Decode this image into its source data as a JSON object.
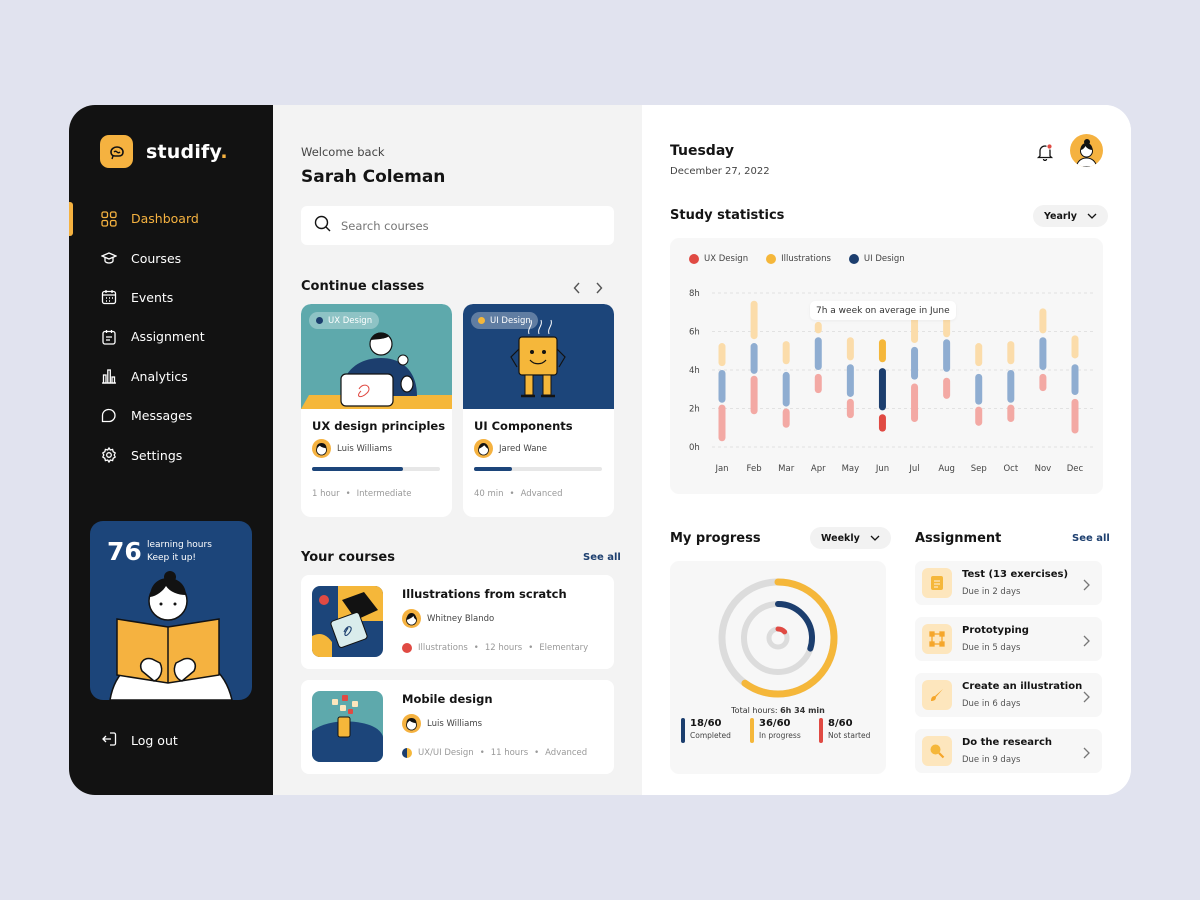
{
  "app": {
    "name": "studify",
    "name_dot": "."
  },
  "sidebar": {
    "items": [
      {
        "label": "Dashboard",
        "icon": "grid-icon"
      },
      {
        "label": "Courses",
        "icon": "graduation-cap-icon"
      },
      {
        "label": "Events",
        "icon": "calendar-icon"
      },
      {
        "label": "Assignment",
        "icon": "clipboard-icon"
      },
      {
        "label": "Analytics",
        "icon": "bar-chart-icon"
      },
      {
        "label": "Messages",
        "icon": "chat-icon"
      },
      {
        "label": "Settings",
        "icon": "gear-icon"
      }
    ],
    "promo": {
      "number": "76",
      "line1": "learning hours",
      "line2": "Keep it up!"
    },
    "logout": "Log out"
  },
  "main": {
    "welcome": "Welcome back",
    "user": "Sarah Coleman",
    "search_placeholder": "Search courses",
    "continue_title": "Continue classes",
    "continue_cards": [
      {
        "tag": "UX Design",
        "title": "UX design principles",
        "author": "Luis Williams",
        "progress": 0.71,
        "duration": "1 hour",
        "level": "Intermediate"
      },
      {
        "tag": "UI Design",
        "title": "UI Components",
        "author": "Jared Wane",
        "progress": 0.3,
        "duration": "40 min",
        "level": "Advanced"
      }
    ],
    "your_courses_title": "Your courses",
    "see_all": "See all",
    "your_courses": [
      {
        "title": "Illustrations from scratch",
        "author": "Whitney Blando",
        "category": "Illustrations",
        "hours": "12 hours",
        "level": "Elementary"
      },
      {
        "title": "Mobile design",
        "author": "Luis Williams",
        "category": "UX/UI Design",
        "hours": "11 hours",
        "level": "Advanced"
      }
    ]
  },
  "right": {
    "day": "Tuesday",
    "date": "December 27, 2022",
    "stats_title": "Study statistics",
    "stats_filter": "Yearly",
    "tooltip": "7h a week on average in June",
    "progress_title": "My progress",
    "progress_filter": "Weekly",
    "total_label": "Total hours:",
    "total_value": "6h 34 min",
    "progress_stats": [
      {
        "value": "18/60",
        "label": "Completed",
        "color": "#1c3e6e"
      },
      {
        "value": "36/60",
        "label": "In progress",
        "color": "#f5b73a"
      },
      {
        "value": "8/60",
        "label": "Not started",
        "color": "#e04a43"
      }
    ],
    "assignment_title": "Assignment",
    "see_all": "See all",
    "assignments": [
      {
        "title": "Test (13 exercises)",
        "due": "Due in 2 days",
        "icon": "document-icon"
      },
      {
        "title": "Prototyping",
        "due": "Due in 5 days",
        "icon": "frame-icon"
      },
      {
        "title": "Create an illustration",
        "due": "Due in 6 days",
        "icon": "brush-icon"
      },
      {
        "title": "Do the research",
        "due": "Due in 9 days",
        "icon": "magnifier-icon"
      }
    ]
  },
  "chart_data": {
    "type": "bar",
    "title": "Study statistics",
    "categories": [
      "Jan",
      "Feb",
      "Mar",
      "Apr",
      "May",
      "Jun",
      "Jul",
      "Aug",
      "Sep",
      "Oct",
      "Nov",
      "Dec"
    ],
    "y_ticks": [
      "0h",
      "2h",
      "4h",
      "6h",
      "8h"
    ],
    "ylim": [
      0,
      8
    ],
    "legend": "top-left",
    "series": [
      {
        "name": "UX Design",
        "color": "#e04a43",
        "ranges": [
          [
            0.3,
            2.2
          ],
          [
            1.7,
            3.7
          ],
          [
            1.0,
            2.0
          ],
          [
            2.8,
            3.8
          ],
          [
            1.5,
            2.5
          ],
          [
            0.8,
            1.7
          ],
          [
            1.3,
            3.3
          ],
          [
            2.5,
            3.6
          ],
          [
            1.1,
            2.1
          ],
          [
            1.3,
            2.2
          ],
          [
            2.9,
            3.8
          ],
          [
            0.7,
            2.5
          ]
        ]
      },
      {
        "name": "UI Design",
        "color": "#1c3e6e",
        "ranges": [
          [
            2.3,
            4.0
          ],
          [
            3.8,
            5.4
          ],
          [
            2.1,
            3.9
          ],
          [
            4.0,
            5.7
          ],
          [
            2.6,
            4.3
          ],
          [
            1.9,
            4.1
          ],
          [
            3.5,
            5.2
          ],
          [
            3.9,
            5.6
          ],
          [
            2.2,
            3.8
          ],
          [
            2.3,
            4.0
          ],
          [
            4.0,
            5.7
          ],
          [
            2.7,
            4.3
          ]
        ]
      },
      {
        "name": "Illustrations",
        "color": "#f5b73a",
        "ranges": [
          [
            4.2,
            5.4
          ],
          [
            5.6,
            7.6
          ],
          [
            4.3,
            5.5
          ],
          [
            5.9,
            6.5
          ],
          [
            4.5,
            5.7
          ],
          [
            4.4,
            5.6
          ],
          [
            5.4,
            6.8
          ],
          [
            5.7,
            6.9
          ],
          [
            4.2,
            5.4
          ],
          [
            4.3,
            5.5
          ],
          [
            5.9,
            7.2
          ],
          [
            4.6,
            5.8
          ]
        ]
      }
    ],
    "highlight": "Jun"
  },
  "progress_ring": {
    "completed": 0.3,
    "in_progress": 0.6,
    "not_started": 0.13
  }
}
